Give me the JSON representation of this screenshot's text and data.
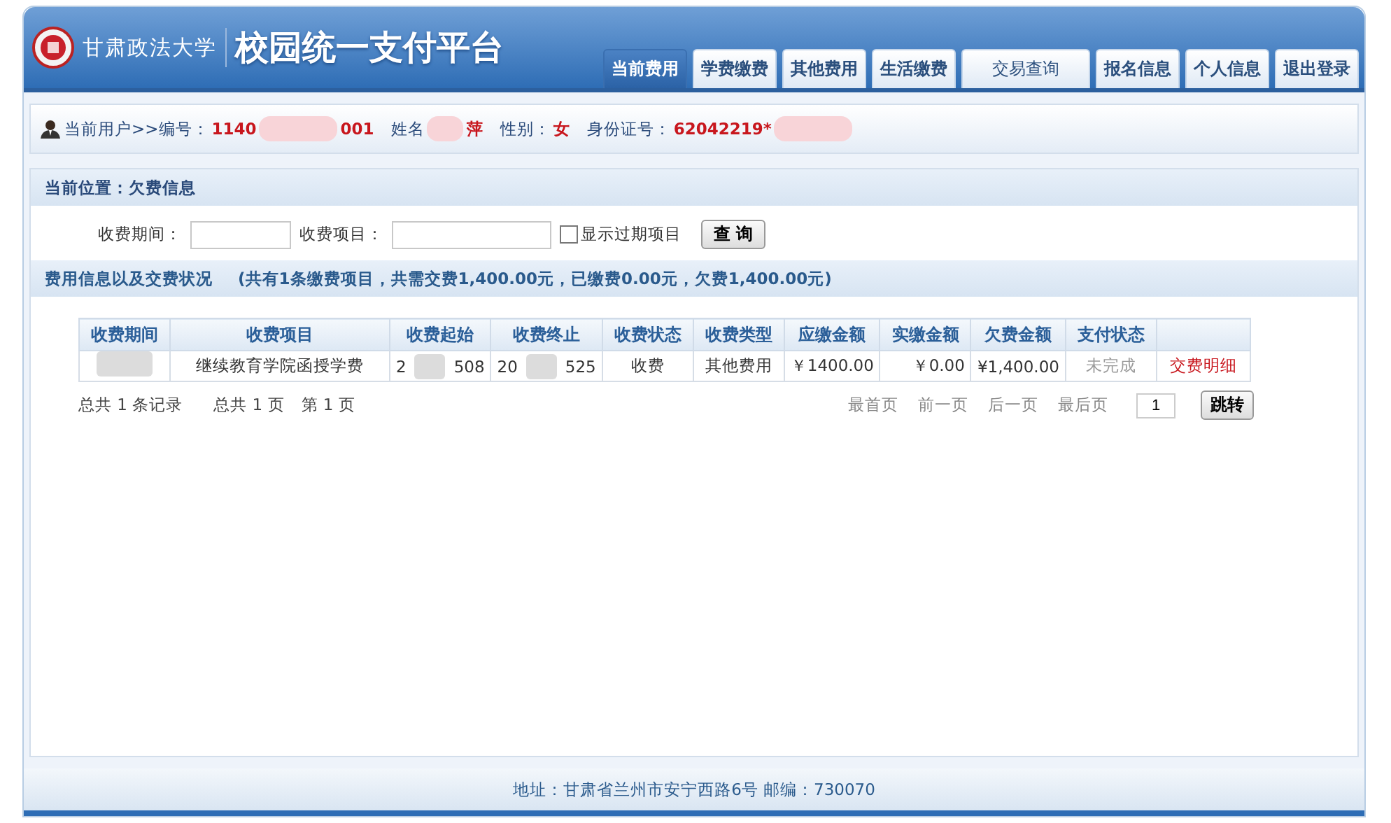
{
  "header": {
    "school_name": "甘肃政法大学",
    "title": "校园统一支付平台"
  },
  "tabs": [
    {
      "label": "当前费用",
      "selected": true
    },
    {
      "label": "学费缴费",
      "selected": false
    },
    {
      "label": "其他费用",
      "selected": false
    },
    {
      "label": "生活缴费",
      "selected": false
    },
    {
      "label": "交易查询",
      "selected": false
    },
    {
      "label": "报名信息",
      "selected": false
    },
    {
      "label": "个人信息",
      "selected": false
    },
    {
      "label": "退出登录",
      "selected": false
    }
  ],
  "user_bar": {
    "label": "当前用户>>编号：",
    "id_parts": [
      "1140",
      "001"
    ],
    "name_label": "姓名",
    "name_parts": [
      "萍"
    ],
    "gender_label": "性别：",
    "gender": "女",
    "idcard_label": "身份证号：",
    "idcard_parts": [
      "62042219*"
    ]
  },
  "location": "当前位置：欠费信息",
  "filters": {
    "period_label": "收费期间：",
    "item_label": "收费项目：",
    "show_expired": {
      "label": "显示过期项目",
      "checked": false
    },
    "query_button": "查 询"
  },
  "summary": {
    "title": "费用信息以及交费状况",
    "detail": "(共有**1**条缴费项目，共需交费**1,400.00**元，已缴费**0.00**元，欠费**1,400.00**元)"
  },
  "table": {
    "columns": [
      "收费期间",
      "收费项目",
      "收费起始",
      "收费终止",
      "收费状态",
      "收费类型",
      "应缴金额",
      "实缴金额",
      "欠费金额",
      "支付状态"
    ],
    "rows": [
      {
        "cells": [
          {
            "kind": "redacted"
          },
          {
            "parts": [
              "继续教育学院函授学费"
            ]
          },
          {
            "parts": [
              "2",
              "508"
            ]
          },
          {
            "parts": [
              "20",
              "525"
            ]
          },
          {
            "parts": [
              "收费"
            ]
          },
          {
            "parts": [
              "其他费用"
            ]
          },
          {
            "parts": [
              "￥1400.00"
            ],
            "kind": "amount"
          },
          {
            "parts": [
              "￥0.00"
            ],
            "kind": "amount"
          },
          {
            "parts": [
              "¥1,400.00"
            ],
            "kind": "amount"
          },
          {
            "parts": [
              "未完成"
            ],
            "kind": "muted"
          },
          {
            "parts": [
              "交费明细"
            ],
            "kind": "link"
          }
        ]
      }
    ]
  },
  "pager": {
    "records": "总共  1 条记录",
    "pages": "总共  1 页",
    "current": "第 1 页",
    "links": [
      "最首页",
      "前一页",
      "后一页",
      "最后页"
    ],
    "page_input": "1",
    "jump_button": "跳转"
  },
  "footer": "地址：甘肃省兰州市安宁西路6号 邮编：730070"
}
